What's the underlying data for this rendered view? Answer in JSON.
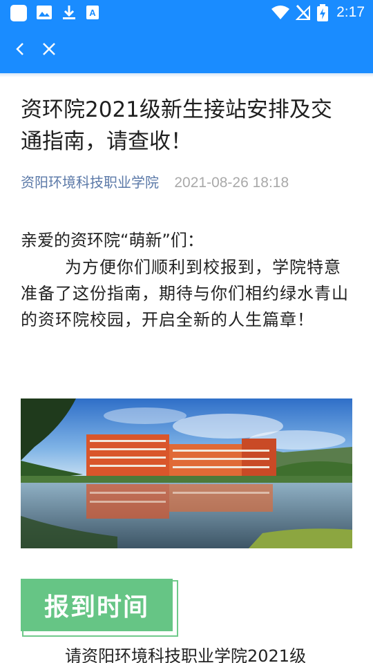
{
  "status_bar": {
    "time": "2:17",
    "icons": [
      "app-square-icon",
      "image-icon",
      "download-icon",
      "a-font-icon",
      "wifi-icon",
      "no-signal-icon",
      "battery-charging-icon"
    ]
  },
  "app_bar": {
    "back_icon": "chevron-left-icon",
    "close_icon": "close-icon"
  },
  "article": {
    "title": "资环院2021级新生接站安排及交通指南，请查收！",
    "author": "资阳环境科技职业学院",
    "date": "2021-08-26 18:18",
    "greeting": "亲爱的资环院“萌新”们：",
    "paragraph": "为方便你们顺利到校报到，学院特意准备了这份指南，期待与你们相约绿水青山的资环院校园，开启全新的人生篇章！",
    "section_title": "报到时间",
    "next_text": "请资阳环境科技职业学院2021级"
  },
  "colors": {
    "primary": "#1a8cff",
    "author_link": "#5b79a8",
    "date_gray": "#a9a9a9",
    "section_green": "#66c585"
  }
}
